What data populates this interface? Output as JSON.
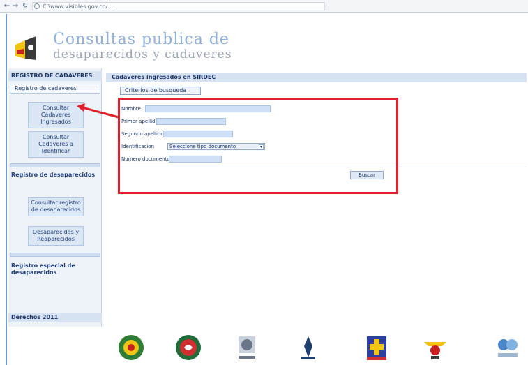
{
  "browser": {
    "url": "C:\\www.visibles.gov.co/..."
  },
  "header": {
    "title_line1": "Consultas publica de",
    "title_line2": "desaparecidos y cadaveres"
  },
  "sidebar": {
    "top_heading": "REGISTRO DE CADAVERES",
    "section1_label": "Registro de cadaveres",
    "section1_buttons": [
      "Consultar Cadaveres Ingresados",
      "Consultar Cadaveres a Identificar"
    ],
    "section2_title": "Registro de desaparecidos",
    "section2_buttons": [
      "Consultar registro de desaparecidos",
      "Desaparecidos y Reaparecidos"
    ],
    "section3_title": "Registro especial de desaparecidos",
    "footer": "Derechos 2011"
  },
  "main": {
    "heading": "Cadaveres ingresados en SIRDEC",
    "tab_label": "Criterios de busqueda",
    "fields": [
      {
        "label": "Nombre",
        "value": ""
      },
      {
        "label": "Primer apellido",
        "value": ""
      },
      {
        "label": "Segundo apellido",
        "value": ""
      },
      {
        "label": "Identificacion",
        "select_value": "Seleccione tipo documento"
      },
      {
        "label": "Numero documento",
        "value": ""
      }
    ],
    "search_button": "Buscar"
  },
  "colors": {
    "annotation": "#e0202b",
    "header_bar": "#d7e3f3",
    "input_fill": "#cfe0f7",
    "frame_border": "#6d9ad4"
  },
  "icons": {
    "browser_nav": [
      "arrow-left-icon",
      "arrow-right-icon",
      "refresh-icon"
    ],
    "footer_logos": [
      "national-police-logo",
      "health-ministry-logo",
      "forensic-institute-logo",
      "prosecutor-logo",
      "ombudsman-logo",
      "army-logo",
      "registry-logo"
    ]
  }
}
